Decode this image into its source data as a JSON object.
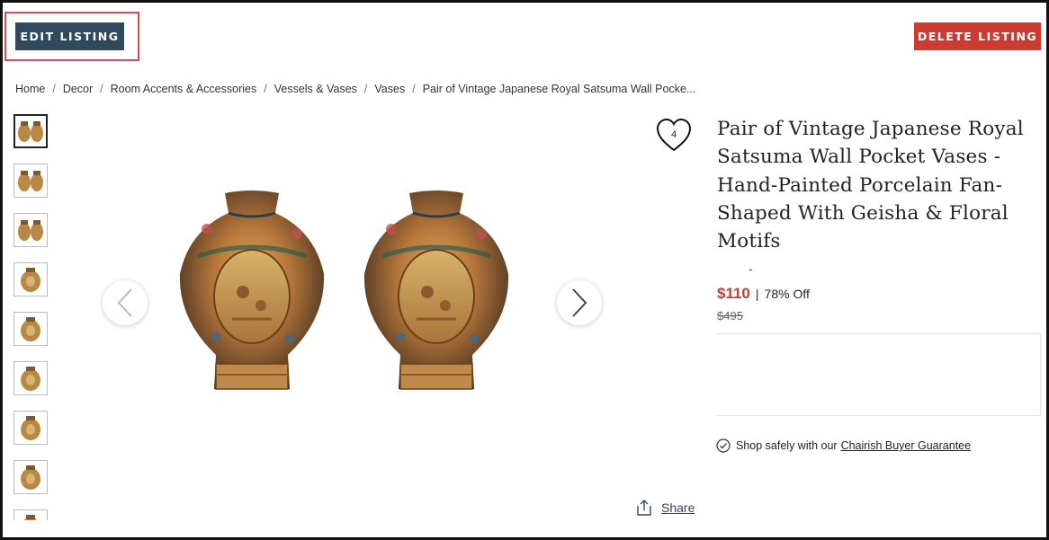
{
  "toolbar": {
    "edit_label": "EDIT LISTING",
    "delete_label": "DELETE LISTING"
  },
  "breadcrumb": {
    "items": [
      "Home",
      "Decor",
      "Room Accents & Accessories",
      "Vessels & Vases",
      "Vases",
      "Pair of Vintage Japanese Royal Satsuma Wall Pocke..."
    ]
  },
  "gallery": {
    "thumbnail_count": 9,
    "active_index": 0,
    "prev_icon": "chevron-left-icon",
    "next_icon": "chevron-right-icon"
  },
  "favorite": {
    "icon": "heart-icon",
    "count": "4"
  },
  "product": {
    "title": "Pair of Vintage Japanese Royal Satsuma Wall Pocket Vases - Hand-Painted Porcelain Fan-Shaped With Geisha & Floral Motifs",
    "dash": "-",
    "price": "$110",
    "separator": "|",
    "discount": "78% Off",
    "original_price": "$495"
  },
  "guarantee": {
    "icon": "check-circle-icon",
    "text": "Shop safely with our",
    "link": "Chairish Buyer Guarantee"
  },
  "share": {
    "icon": "share-icon",
    "label": "Share"
  },
  "colors": {
    "edit_button": "#2f4a5c",
    "delete_button": "#cb3b32",
    "price": "#c73b2f",
    "highlight": "#e3474f"
  }
}
